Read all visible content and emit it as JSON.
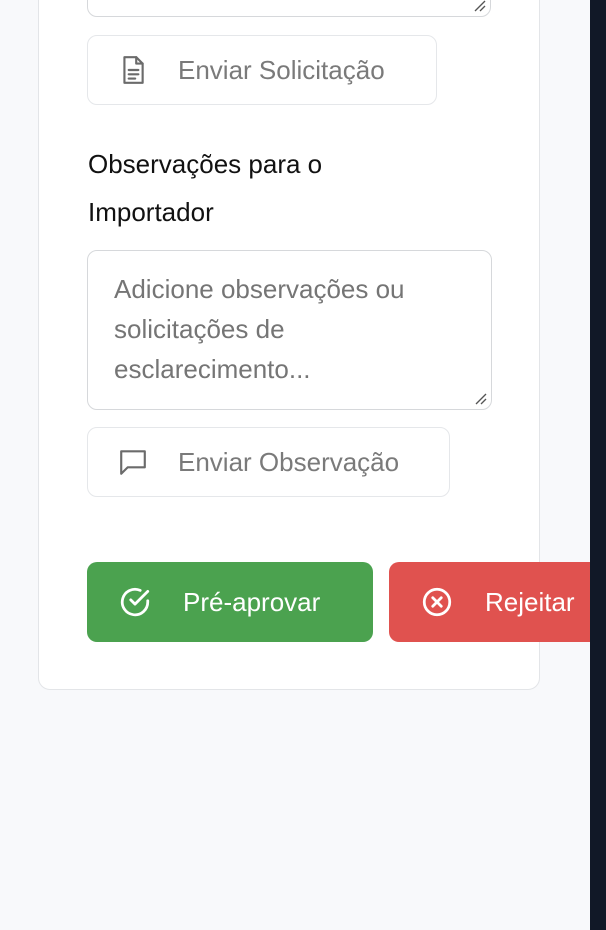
{
  "solicitacao": {
    "send_button": "Enviar Solicitação",
    "icon": "document-icon"
  },
  "observacoes": {
    "title": "Observações para o Importador",
    "placeholder": "Adicione observações ou solicitações de esclarecimento...",
    "send_button": "Enviar Observação",
    "icon": "message-square-icon"
  },
  "actions": {
    "approve": {
      "label": "Pré-aprovar",
      "color": "#4ba24f",
      "icon": "check-circle-icon"
    },
    "reject": {
      "label": "Rejeitar",
      "color": "#e0524f",
      "icon": "x-circle-icon"
    }
  }
}
